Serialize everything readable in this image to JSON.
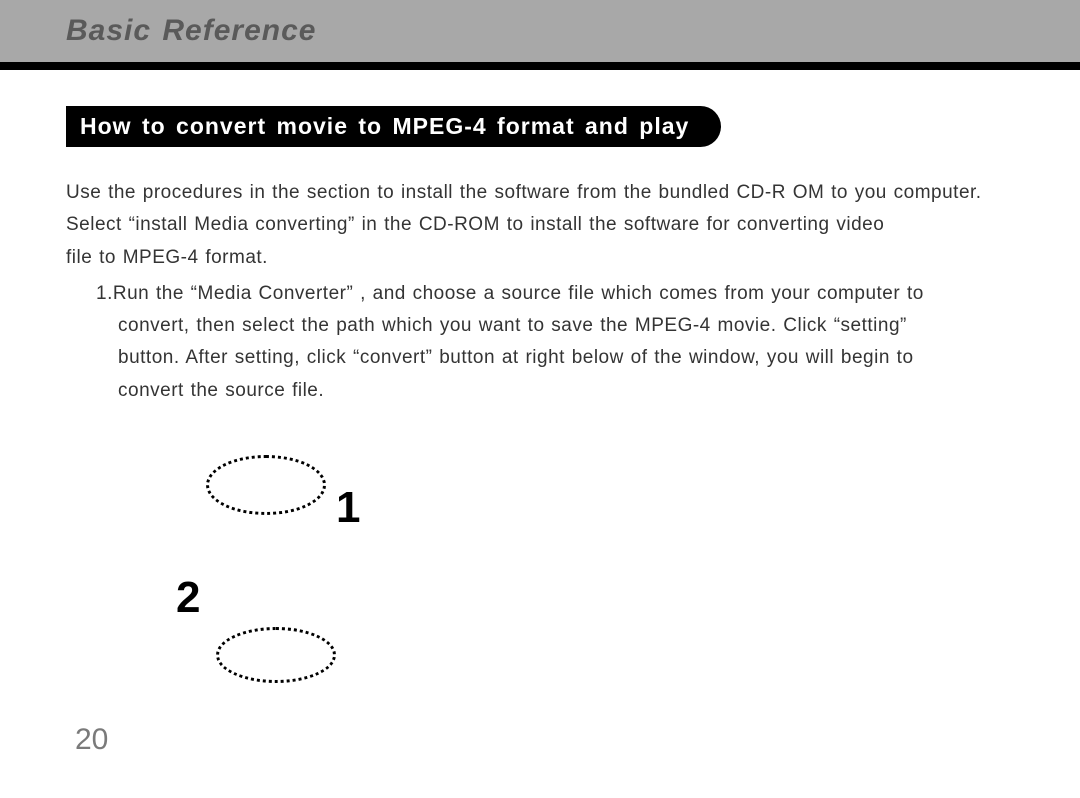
{
  "header": {
    "title": "Basic Reference"
  },
  "section": {
    "heading": "How to convert movie to MPEG-4 format and play"
  },
  "intro": {
    "line1": "Use the procedures in the section to install the software from the bundled CD-R OM to you computer.",
    "line2": "Select “install Media converting” in the CD-ROM to install the software for converting video",
    "line3": "file to MPEG-4 format."
  },
  "steps": {
    "item1": {
      "number": "1.",
      "first_line": "Run the “Media Converter” , and choose a source file which comes from your computer to",
      "cont1": "convert, then select the path which you want to save the MPEG-4 movie. Click “setting”",
      "cont2": "button. After setting, click “convert” button at right below of the window, you will begin to",
      "cont3": "convert the source file."
    }
  },
  "callouts": {
    "one": "1",
    "two": "2"
  },
  "page": {
    "number": "20"
  }
}
